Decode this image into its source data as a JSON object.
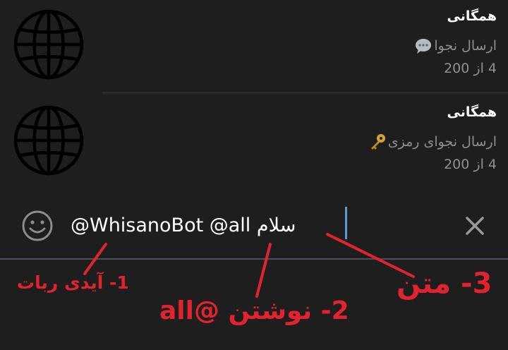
{
  "results": [
    {
      "title": "همگانی",
      "subtitle": "ارسال نجوا",
      "subtitle_icon": "speech-bubble-icon",
      "count": "4 از 200"
    },
    {
      "title": "همگانی",
      "subtitle": "ارسال نجوای رمزی",
      "subtitle_icon": "key-icon",
      "count": "4 از 200"
    }
  ],
  "input": {
    "part1": "@WhisanoBot @all ",
    "part2": "سلام"
  },
  "annotations": {
    "bot_id": "1- آیدی ربات",
    "write_all": "2- نوشتن @all",
    "text": "3- متن"
  },
  "colors": {
    "background": "#1e1e1e",
    "annotation": "#e0232f",
    "caret": "#5b9bd5",
    "muted": "#8f8f8f"
  }
}
